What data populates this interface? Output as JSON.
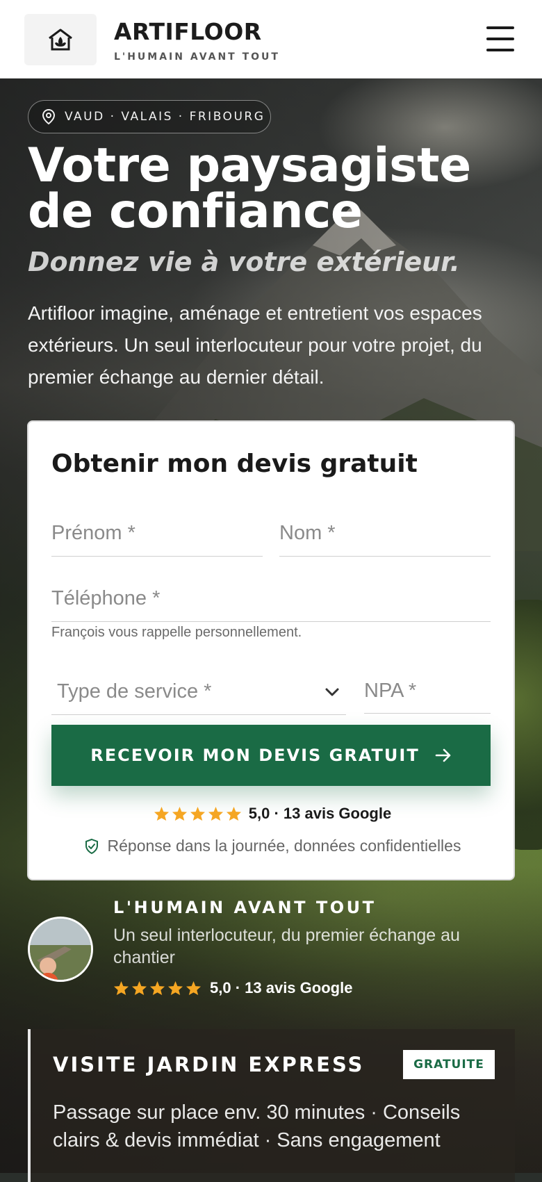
{
  "header": {
    "brand": "ARTIFLOOR",
    "tagline": "L'HUMAIN AVANT TOUT",
    "logo_icon": "house-leaf-icon",
    "menu_icon": "hamburger-menu-icon"
  },
  "hero": {
    "region_icon": "map-pin-icon",
    "region": "VAUD · VALAIS · FRIBOURG",
    "title": "Votre paysagiste de confiance",
    "subtitle": "Donnez vie à votre extérieur.",
    "lead": "Artifloor imagine, aménage et entretient vos espaces extérieurs. Un seul interlocuteur pour votre projet, du premier échange au dernier détail."
  },
  "form": {
    "title": "Obtenir mon devis gratuit",
    "prenom_placeholder": "Prénom *",
    "nom_placeholder": "Nom *",
    "telephone_placeholder": "Téléphone *",
    "hint": "François vous rappelle personnellement.",
    "service_label": "Type de service *",
    "npa_placeholder": "NPA *",
    "submit_label": "RECEVOIR MON DEVIS GRATUIT",
    "rating": "5,0 · 13 avis Google",
    "stars": 5,
    "reassurance": "Réponse dans la journée, données confidentielles"
  },
  "owner": {
    "title": "L'HUMAIN AVANT TOUT",
    "description": "Un seul interlocuteur, du premier échange au chantier",
    "rating": "5,0 · 13 avis Google",
    "stars": 5
  },
  "express": {
    "title": "VISITE JARDIN EXPRESS",
    "badge": "GRATUITE",
    "description": "Passage sur place env. 30 minutes · Conseils clairs & devis immédiat · Sans engagement"
  },
  "colors": {
    "primary_green": "#1a6b45",
    "star_yellow": "#f5a623"
  }
}
